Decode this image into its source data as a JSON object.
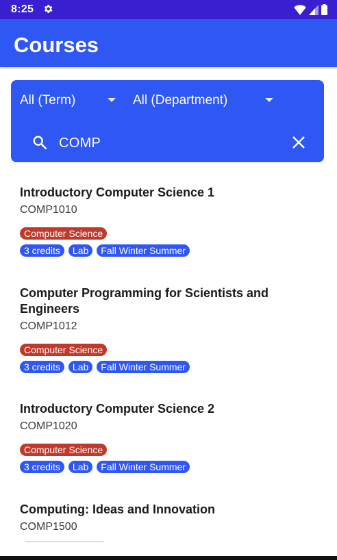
{
  "status_bar": {
    "time": "8:25"
  },
  "app_bar": {
    "title": "Courses"
  },
  "filters": {
    "term_selected": "All (Term)",
    "department_selected": "All (Department)",
    "search_value": "COMP"
  },
  "courses": [
    {
      "title": "Introductory Computer Science 1",
      "code": "COMP1010",
      "department": "Computer Science",
      "tags": [
        "3 credits",
        "Lab",
        "Fall Winter Summer"
      ]
    },
    {
      "title": "Computer Programming for Scientists and Engineers",
      "code": "COMP1012",
      "department": "Computer Science",
      "tags": [
        "3 credits",
        "Lab",
        "Fall Winter Summer"
      ]
    },
    {
      "title": "Introductory Computer Science 2",
      "code": "COMP1020",
      "department": "Computer Science",
      "tags": [
        "3 credits",
        "Lab",
        "Fall Winter Summer"
      ]
    },
    {
      "title": "Computing: Ideas and Innovation",
      "code": "COMP1500"
    }
  ],
  "colors": {
    "status_bar": "#3a1fd1",
    "primary": "#2f57f3",
    "department_chip": "#c0392b"
  },
  "icons": [
    "gear-icon",
    "wifi-icon",
    "signal-icon",
    "battery-icon",
    "search-icon",
    "close-icon",
    "dropdown-arrow-icon"
  ]
}
